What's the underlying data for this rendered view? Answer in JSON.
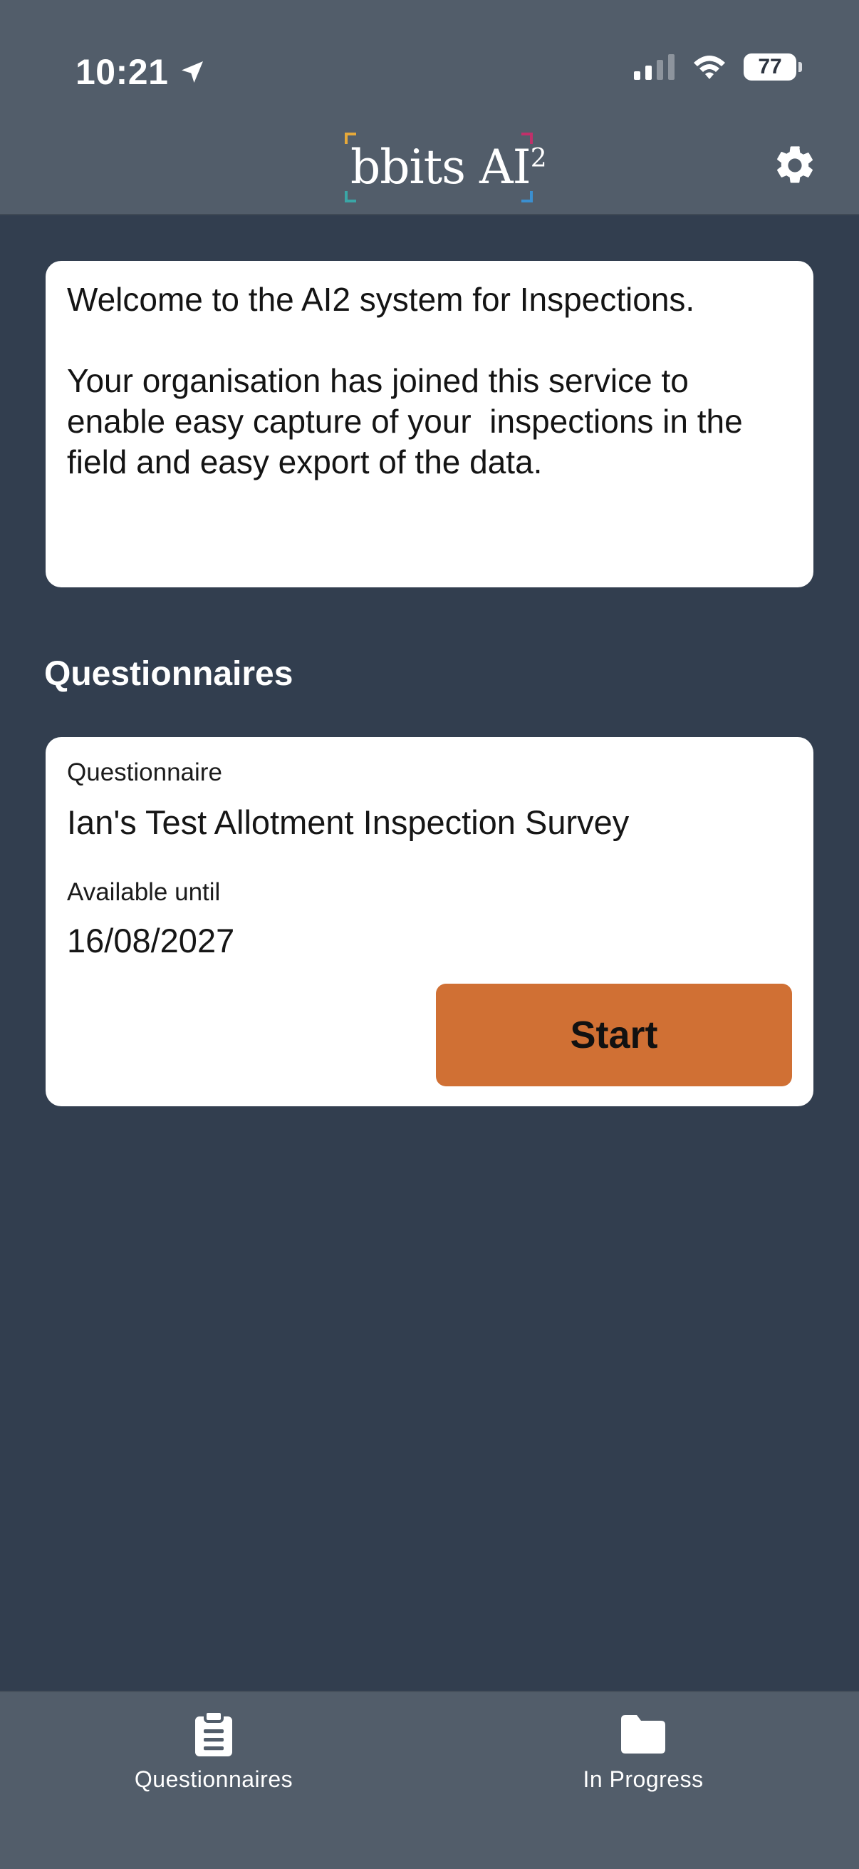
{
  "status_bar": {
    "time": "10:21",
    "battery": "77"
  },
  "header": {
    "logo_text": "bbits AI",
    "logo_superscript": "2"
  },
  "welcome": {
    "text": "Welcome to the AI2 system for Inspections.\n\nYour organisation has joined this service to enable easy capture of your  inspections in the field and easy export of the data."
  },
  "questionnaires": {
    "section_title": "Questionnaires",
    "items": [
      {
        "questionnaire_label": "Questionnaire",
        "questionnaire_name": "Ian's Test Allotment Inspection Survey",
        "available_label": "Available until",
        "available_date": "16/08/2027",
        "start_label": "Start"
      }
    ]
  },
  "tabs": [
    {
      "label": "Questionnaires",
      "icon": "clipboard-icon"
    },
    {
      "label": "In Progress",
      "icon": "folder-icon"
    }
  ],
  "colors": {
    "background": "#323e4f",
    "header": "#525d6a",
    "accent": "#d07034",
    "card": "#ffffff"
  }
}
